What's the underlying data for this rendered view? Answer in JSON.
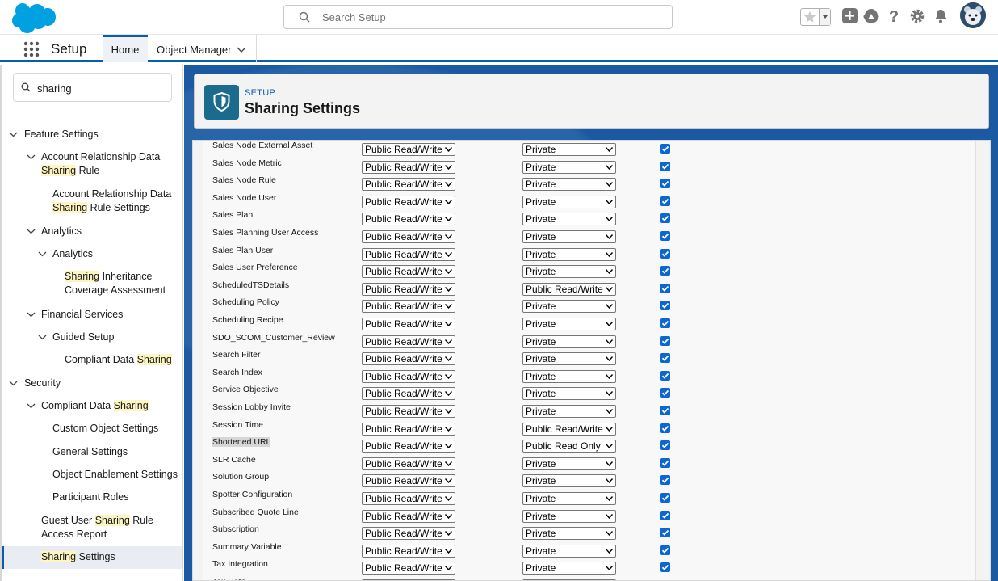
{
  "header": {
    "search_placeholder": "Search Setup"
  },
  "nav": {
    "app_name": "Setup",
    "tabs": [
      {
        "label": "Home"
      },
      {
        "label": "Object Manager"
      }
    ]
  },
  "sidebar": {
    "quick_find_value": "sharing",
    "highlight_term": "Sharing",
    "items": [
      {
        "label": "Feature Settings"
      },
      {
        "label_pre": "Account Relationship Data ",
        "label_hl": "Sharing",
        "label_post": " Rule"
      },
      {
        "label_pre": "Account Relationship Data ",
        "label_hl": "Sharing",
        "label_post": " Rule Settings"
      },
      {
        "label": "Analytics"
      },
      {
        "label": "Analytics"
      },
      {
        "label_pre": "",
        "label_hl": "Sharing",
        "label_post": " Inheritance Coverage Assessment"
      },
      {
        "label": "Financial Services"
      },
      {
        "label": "Guided Setup"
      },
      {
        "label_pre": "Compliant Data ",
        "label_hl": "Sharing",
        "label_post": ""
      },
      {
        "label": "Security"
      },
      {
        "label_pre": "Compliant Data ",
        "label_hl": "Sharing",
        "label_post": ""
      },
      {
        "label": "Custom Object Settings"
      },
      {
        "label": "General Settings"
      },
      {
        "label": "Object Enablement Settings"
      },
      {
        "label": "Participant Roles"
      },
      {
        "label_pre": "Guest User ",
        "label_hl": "Sharing",
        "label_post": " Rule Access Report"
      },
      {
        "label_pre": "",
        "label_hl": "Sharing",
        "label_post": " Settings"
      }
    ]
  },
  "page_header": {
    "eyebrow": "SETUP",
    "title": "Sharing Settings"
  },
  "table": {
    "rows": [
      {
        "name": "Sales Node External Asset",
        "default_internal": "Public Read/Write",
        "default_external": "Private",
        "grant_access": true
      },
      {
        "name": "Sales Node Metric",
        "default_internal": "Public Read/Write",
        "default_external": "Private",
        "grant_access": true
      },
      {
        "name": "Sales Node Rule",
        "default_internal": "Public Read/Write",
        "default_external": "Private",
        "grant_access": true
      },
      {
        "name": "Sales Node User",
        "default_internal": "Public Read/Write",
        "default_external": "Private",
        "grant_access": true
      },
      {
        "name": "Sales Plan",
        "default_internal": "Public Read/Write",
        "default_external": "Private",
        "grant_access": true
      },
      {
        "name": "Sales Planning User Access",
        "default_internal": "Public Read/Write",
        "default_external": "Private",
        "grant_access": true
      },
      {
        "name": "Sales Plan User",
        "default_internal": "Public Read/Write",
        "default_external": "Private",
        "grant_access": true
      },
      {
        "name": "Sales User Preference",
        "default_internal": "Public Read/Write",
        "default_external": "Private",
        "grant_access": true
      },
      {
        "name": "ScheduledTSDetails",
        "default_internal": "Public Read/Write",
        "default_external": "Public Read/Write",
        "grant_access": true
      },
      {
        "name": "Scheduling Policy",
        "default_internal": "Public Read/Write",
        "default_external": "Private",
        "grant_access": true
      },
      {
        "name": "Scheduling Recipe",
        "default_internal": "Public Read/Write",
        "default_external": "Private",
        "grant_access": true
      },
      {
        "name": "SDO_SCOM_Customer_Review",
        "default_internal": "Public Read/Write",
        "default_external": "Private",
        "grant_access": true
      },
      {
        "name": "Search Filter",
        "default_internal": "Public Read/Write",
        "default_external": "Private",
        "grant_access": true
      },
      {
        "name": "Search Index",
        "default_internal": "Public Read/Write",
        "default_external": "Private",
        "grant_access": true
      },
      {
        "name": "Service Objective",
        "default_internal": "Public Read/Write",
        "default_external": "Private",
        "grant_access": true
      },
      {
        "name": "Session Lobby Invite",
        "default_internal": "Public Read/Write",
        "default_external": "Private",
        "grant_access": true
      },
      {
        "name": "Session Time",
        "default_internal": "Public Read/Write",
        "default_external": "Public Read/Write",
        "grant_access": true
      },
      {
        "name": "Shortened URL",
        "default_internal": "Public Read/Write",
        "default_external": "Public Read Only",
        "grant_access": true
      },
      {
        "name": "SLR Cache",
        "default_internal": "Public Read/Write",
        "default_external": "Private",
        "grant_access": true
      },
      {
        "name": "Solution Group",
        "default_internal": "Public Read/Write",
        "default_external": "Private",
        "grant_access": true
      },
      {
        "name": "Spotter Configuration",
        "default_internal": "Public Read/Write",
        "default_external": "Private",
        "grant_access": true
      },
      {
        "name": "Subscribed Quote Line",
        "default_internal": "Public Read/Write",
        "default_external": "Private",
        "grant_access": true
      },
      {
        "name": "Subscription",
        "default_internal": "Public Read/Write",
        "default_external": "Private",
        "grant_access": true
      },
      {
        "name": "Summary Variable",
        "default_internal": "Public Read/Write",
        "default_external": "Private",
        "grant_access": true
      },
      {
        "name": "Tax Integration",
        "default_internal": "Public Read/Write",
        "default_external": "Private",
        "grant_access": true
      },
      {
        "name": "Tax Rate",
        "default_internal": "Public Read/Write",
        "default_external": "Private",
        "grant_access": true
      }
    ]
  },
  "colors": {
    "brand_blue": "#0b5cab",
    "salesforce_cloud": "#00a1e0",
    "checkbox": "#0b66d6",
    "highlight": "#fdf6c3"
  },
  "icons": [
    "salesforce-cloud-logo",
    "search-icon",
    "favorites-star-icon",
    "add-icon",
    "trailhead-icon",
    "help-icon",
    "gear-icon",
    "bell-icon",
    "avatar",
    "app-launcher-icon",
    "chevron-down-icon",
    "shield-icon",
    "checkbox-checked-icon"
  ]
}
